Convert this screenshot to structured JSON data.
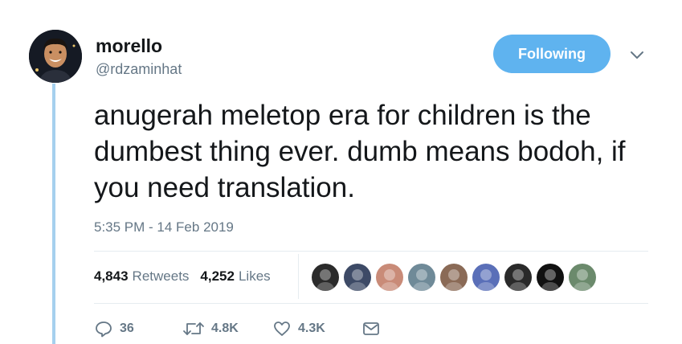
{
  "user": {
    "name": "morello",
    "handle": "@rdzaminhat",
    "avatar_icon": "profile-photo"
  },
  "follow_button": {
    "label": "Following"
  },
  "menu_icon": "chevron-down-icon",
  "tweet": {
    "text": "anugerah meletop era for children is the dumbest thing ever. dumb means bodoh, if you need translation.",
    "timestamp": "5:35 PM - 14 Feb 2019"
  },
  "stats": {
    "retweets_count": "4,843",
    "retweets_label": "Retweets",
    "likes_count": "4,252",
    "likes_label": "Likes"
  },
  "likers": [
    {
      "icon": "liker-avatar",
      "bg": "#2b2b2b"
    },
    {
      "icon": "liker-avatar",
      "bg": "#3d4a66"
    },
    {
      "icon": "liker-avatar",
      "bg": "#c98b78"
    },
    {
      "icon": "liker-avatar",
      "bg": "#6f8a98"
    },
    {
      "icon": "liker-avatar",
      "bg": "#8a6a56"
    },
    {
      "icon": "liker-avatar",
      "bg": "#5a6fb8"
    },
    {
      "icon": "liker-avatar",
      "bg": "#2a2a2a"
    },
    {
      "icon": "liker-avatar",
      "bg": "#111111"
    },
    {
      "icon": "liker-avatar",
      "bg": "#6b8a6c"
    }
  ],
  "actions": {
    "replies": "36",
    "retweets": "4.8K",
    "likes": "4.3K"
  },
  "colors": {
    "accent": "#1da1f2",
    "follow_bg": "#5fb3ef",
    "thread_line": "#a5d0ee",
    "muted": "#657786",
    "text": "#14171a"
  }
}
